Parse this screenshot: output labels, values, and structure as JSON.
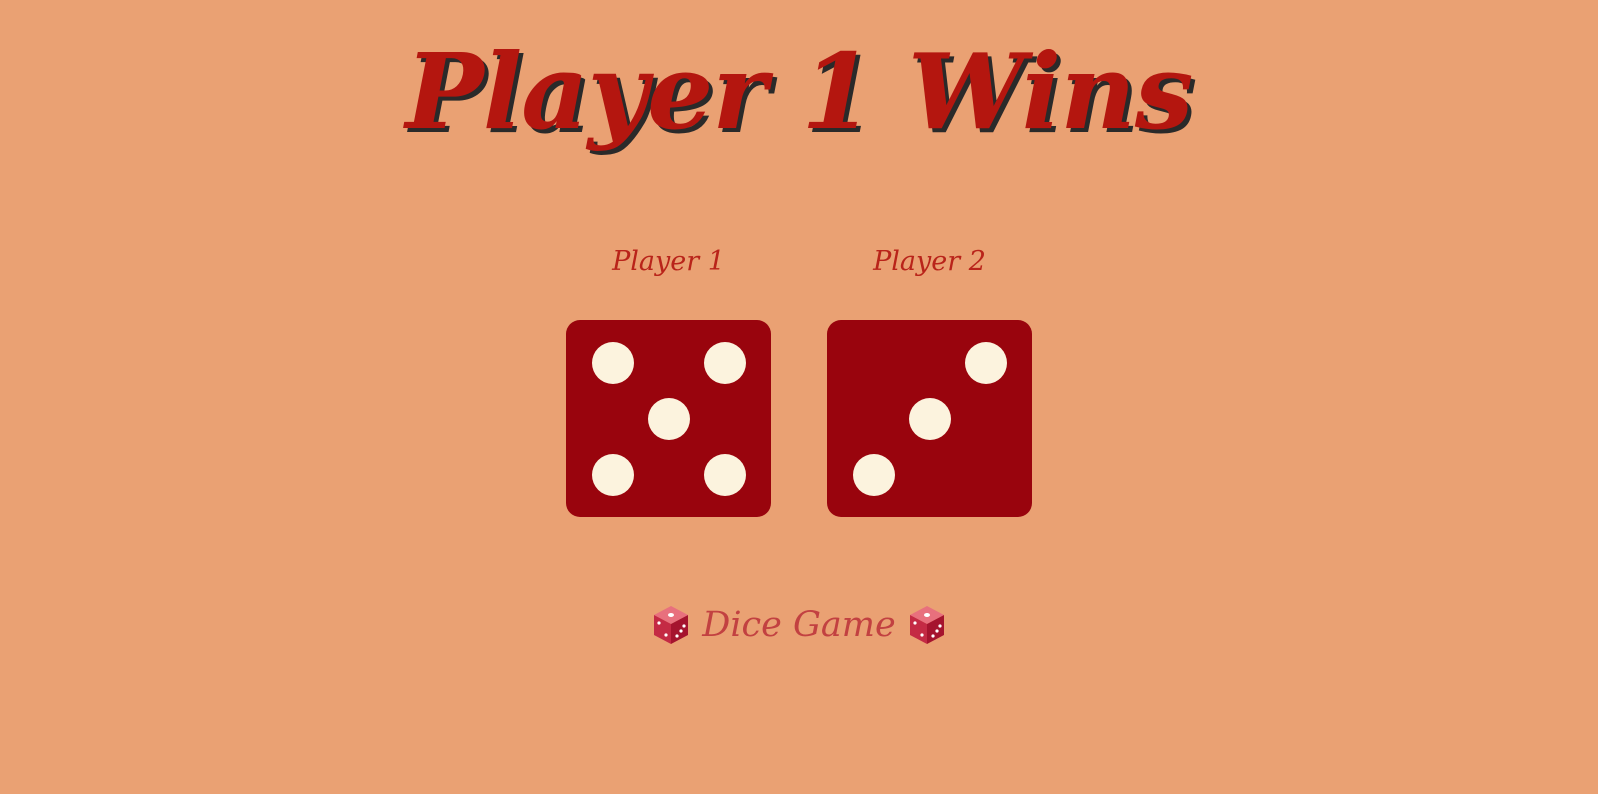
{
  "game": {
    "result_title": "Player 1 Wins",
    "player1": {
      "label": "Player 1",
      "die_value": 5
    },
    "player2": {
      "label": "Player 2",
      "die_value": 3
    },
    "footer_title": "Dice Game",
    "footer_icon": "dice-emoji-icon"
  },
  "colors": {
    "background": "#EAA173",
    "title": "#B4160F",
    "title_shadow": "#2A2A2A",
    "label": "#B9241A",
    "die_face": "#99040D",
    "pip": "#FCF3DE",
    "footer": "#C24141"
  }
}
